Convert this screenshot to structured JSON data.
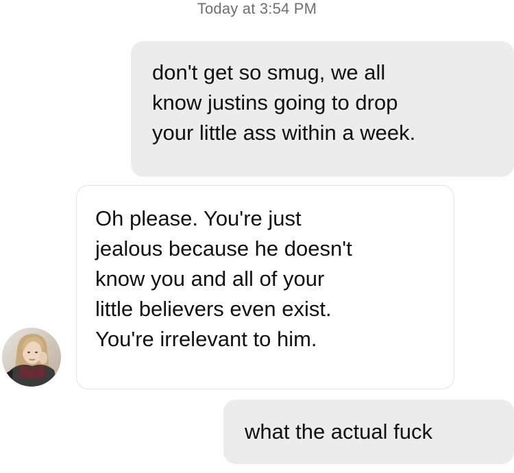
{
  "conversation": {
    "timestamp": "Today at 3:54 PM",
    "messages": [
      {
        "direction": "sent",
        "lines": [
          "don't get so smug, we all",
          "know justins going to drop",
          "your little ass within a week."
        ]
      },
      {
        "direction": "received",
        "lines": [
          "Oh please. You're just",
          "jealous because he doesn't",
          "know you and all of your",
          "little believers even exist.",
          "You're irrelevant to him."
        ]
      },
      {
        "direction": "sent",
        "lines": [
          "what the actual fuck"
        ]
      }
    ]
  },
  "colors": {
    "sent_bubble": "#ececec",
    "received_bubble": "#ffffff",
    "received_border": "#e3e3e3",
    "timestamp_text": "#6f6f6f",
    "message_text": "#111111"
  },
  "icons": {
    "avatar": "contact-avatar-photo"
  }
}
